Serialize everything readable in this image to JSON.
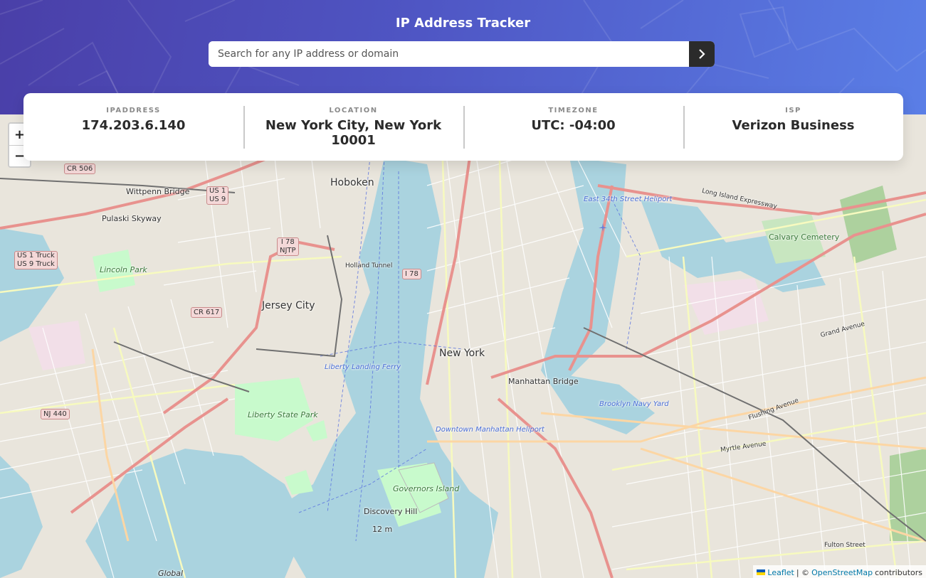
{
  "header": {
    "title": "IP Address Tracker",
    "search_placeholder": "Search for any IP address or domain",
    "search_value": ""
  },
  "info": {
    "ip": {
      "label": "IPADDRESS",
      "value": "174.203.6.140"
    },
    "location": {
      "label": "LOCATION",
      "value": "New York City, New York 10001"
    },
    "timezone": {
      "label": "TIMEZONE",
      "value": "UTC: -04:00"
    },
    "isp": {
      "label": "ISP",
      "value": "Verizon Business"
    }
  },
  "map": {
    "zoom_in": "+",
    "zoom_out": "−",
    "labels": {
      "hoboken": "Hoboken",
      "jersey_city": "Jersey City",
      "new_york": "New York",
      "manhattan_bridge": "Manhattan Bridge",
      "liberty_state_park": "Liberty State Park",
      "governors_island": "Governors Island",
      "pulaski_skyway": "Pulaski Skyway",
      "witpenn_bridge": "Wittpenn Bridge",
      "calvary_cemetery": "Calvary Cemetery",
      "lincoln_park": "Lincoln Park",
      "discovery_hill": "Discovery Hill",
      "discovery_hill_elev": "12 m",
      "global": "Global",
      "holland_tunnel": "Holland Tunnel",
      "downtown_heliport": "Downtown Manhattan Heliport",
      "east_34th_heliport": "East 34th Street Heliport",
      "brooklyn_navy_yard": "Brooklyn Navy Yard",
      "liberty_landing_ferry": "Liberty Landing Ferry",
      "flushing_avenue": "Flushing Avenue",
      "myrtle_avenue": "Myrtle Avenue",
      "fulton_street": "Fulton Street",
      "grand_avenue": "Grand Avenue",
      "long_island_expressway": "Long Island Expressway"
    },
    "shields": {
      "cr506": "CR 506",
      "us1": "US 1",
      "us9": "US 9",
      "i78_njtp": "I 78",
      "njtp": "NJTP",
      "us1_truck": "US 1 Truck",
      "us9_truck": "US 9 Truck",
      "i78": "I 78",
      "cr617": "CR 617",
      "nj440": "NJ 440"
    }
  },
  "attribution": {
    "leaflet": "Leaflet",
    "separator": "| ©",
    "osm": "OpenStreetMap",
    "suffix": "contributors"
  }
}
